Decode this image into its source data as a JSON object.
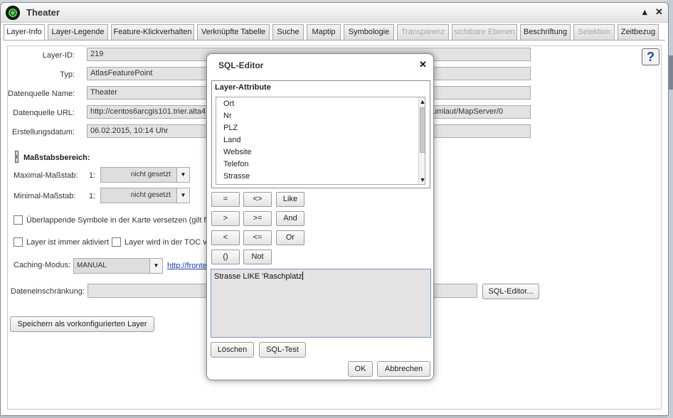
{
  "window": {
    "title": "Theater"
  },
  "tabs": [
    {
      "label": "Layer-Info",
      "state": "active"
    },
    {
      "label": "Layer-Legende",
      "state": "normal"
    },
    {
      "label": "Feature-Klickverhalten",
      "state": "normal"
    },
    {
      "label": "Verknüpfte Tabelle",
      "state": "normal"
    },
    {
      "label": "Suche",
      "state": "normal"
    },
    {
      "label": "Maptip",
      "state": "normal"
    },
    {
      "label": "Symbologie",
      "state": "normal"
    },
    {
      "label": "Transparenz",
      "state": "disabled"
    },
    {
      "label": "sichtbare Ebenen",
      "state": "disabled"
    },
    {
      "label": "Beschriftung",
      "state": "normal"
    },
    {
      "label": "Selektion",
      "state": "disabled"
    },
    {
      "label": "Zeitbezug",
      "state": "normal"
    }
  ],
  "info": {
    "layer_id_label": "Layer-ID:",
    "layer_id": "219",
    "typ_label": "Typ:",
    "typ": "AtlasFeaturePoint",
    "ds_name_label": "Datenquelle Name:",
    "ds_name": "Theater",
    "ds_url_label": "Datenquelle URL:",
    "ds_url_left": "http://centos6arcgis101.trier.alta4.",
    "ds_url_right": "umlaut/MapServer/0",
    "created_label": "Erstellungsdatum:",
    "created": "06.02.2015, 10:14 Uhr"
  },
  "scale": {
    "title": "Maßstabsbereich:",
    "max_label": "Maximal-Maßstab:",
    "max_prefix": "1:",
    "max_value": "nicht gesetzt",
    "min_label": "Minimal-Maßstab:",
    "min_prefix": "1:",
    "min_value": "nicht gesetzt"
  },
  "options": {
    "overlap_label": "Überlappende Symbole in der Karte versetzen (gilt fü",
    "always_active_label": "Layer ist immer aktiviert",
    "toc_label": "Layer wird in der TOC v",
    "caching_label": "Caching-Modus:",
    "caching_value": "MANUAL",
    "caching_link": "http://fronte",
    "restriction_label": "Dateneinschränkung:",
    "sql_editor_btn": "SQL-Editor...",
    "save_preconfig_btn": "Speichern als vorkonfigurierten Layer"
  },
  "sql_dialog": {
    "title": "SQL-Editor",
    "attr_title": "Layer-Attribute",
    "attributes": [
      "Ort",
      "Nr",
      "PLZ",
      "Land",
      "Website",
      "Telefon",
      "Strasse"
    ],
    "operators": [
      "=",
      "<>",
      "Like",
      ">",
      ">=",
      "And",
      "<",
      "<=",
      "Or",
      "()",
      "Not"
    ],
    "query": "Strasse LIKE 'Raschplatz",
    "clear_btn": "Löschen",
    "test_btn": "SQL-Test",
    "ok_btn": "OK",
    "cancel_btn": "Abbrechen"
  }
}
